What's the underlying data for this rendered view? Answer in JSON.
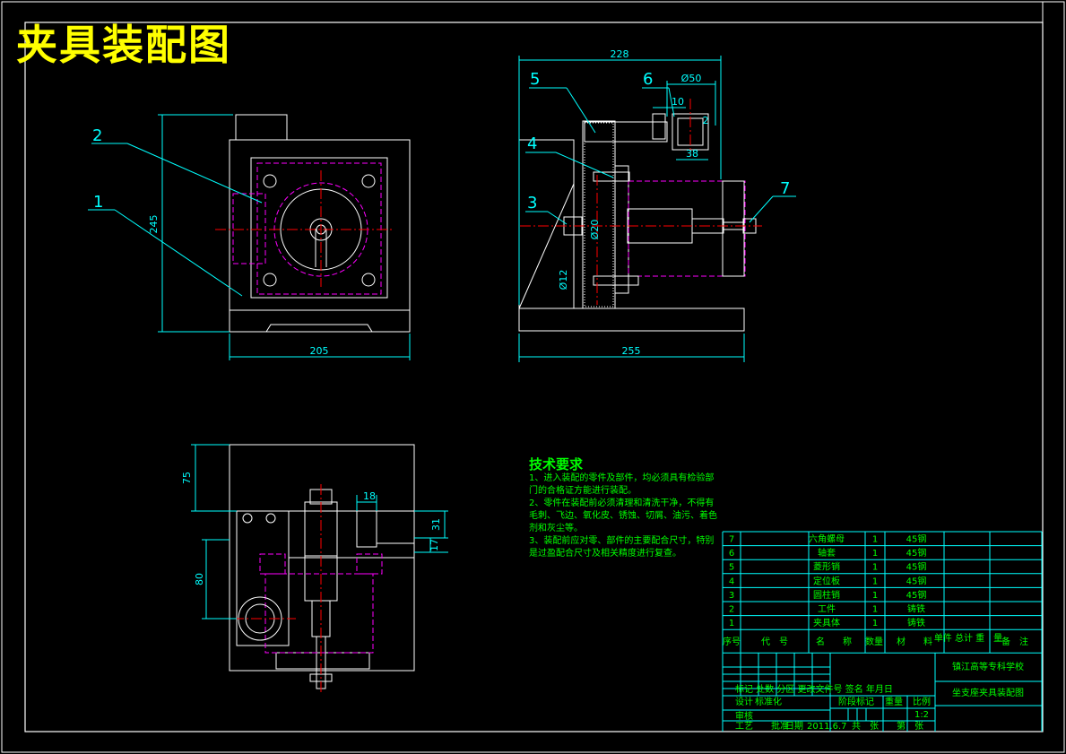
{
  "title": "夹具装配图",
  "colors": {
    "background": "#000000",
    "frame": "#ffffff",
    "dimension": "#00ffff",
    "hidden": "#ff00ff",
    "text": "#00ff00",
    "title": "#ffff00",
    "center": "#ff0000"
  },
  "front_view": {
    "dims": [
      "245",
      "205"
    ],
    "leaders": [
      "2",
      "1"
    ]
  },
  "side_view": {
    "dims": [
      "228",
      "Ø50",
      "10",
      "2",
      "38",
      "Ø20",
      "Ø12",
      "255"
    ],
    "leaders": [
      "5",
      "6",
      "4",
      "3",
      "7"
    ]
  },
  "top_view": {
    "dims": [
      "75",
      "18",
      "31",
      "17",
      "80"
    ]
  },
  "tech": {
    "heading": "技术要求",
    "lines": [
      "1、进入装配的零件及部件，均必须具有检验部门的合格证方能进行装配。",
      "2、零件在装配前必须清理和清洗干净，不得有毛刺、飞边、氧化皮、锈蚀、切屑、油污、着色剂和灰尘等。",
      "3、装配前应对零、部件的主要配合尺寸，特别是过盈配合尺寸及相关精度进行复查。"
    ]
  },
  "bom": {
    "rows": [
      {
        "no": "7",
        "name": "六角螺母",
        "qty": "1",
        "material": "45钢"
      },
      {
        "no": "6",
        "name": "轴套",
        "qty": "1",
        "material": "45钢"
      },
      {
        "no": "5",
        "name": "菱形销",
        "qty": "1",
        "material": "45钢"
      },
      {
        "no": "4",
        "name": "定位板",
        "qty": "1",
        "material": "45钢"
      },
      {
        "no": "3",
        "name": "圆柱销",
        "qty": "1",
        "material": "45钢"
      },
      {
        "no": "2",
        "name": "工件",
        "qty": "1",
        "material": "铸铁"
      },
      {
        "no": "1",
        "name": "夹具体",
        "qty": "1",
        "material": "铸铁"
      }
    ],
    "header": {
      "no": "序号",
      "code": "代　号",
      "name": "名　　称",
      "qty": "数量",
      "material": "材　　料",
      "weight": "单件 总计 重　量",
      "remark": "备　注"
    }
  },
  "title_block": {
    "school": "镇江高等专科学校",
    "drawing_name": "坐支座夹具装配图",
    "stage_mark": "阶段标记",
    "weight": "重量",
    "scale_label": "比例",
    "scale": "1:2",
    "design": "设计",
    "review": "审核",
    "process": "工艺",
    "standardization": "标准化",
    "date_label": "日期",
    "date": "2011.6.7",
    "approve": "批准",
    "total": "共　张",
    "sheet": "第　张",
    "revision_fields": "标记 处数 分区 更改文件号 签名 年月日"
  }
}
